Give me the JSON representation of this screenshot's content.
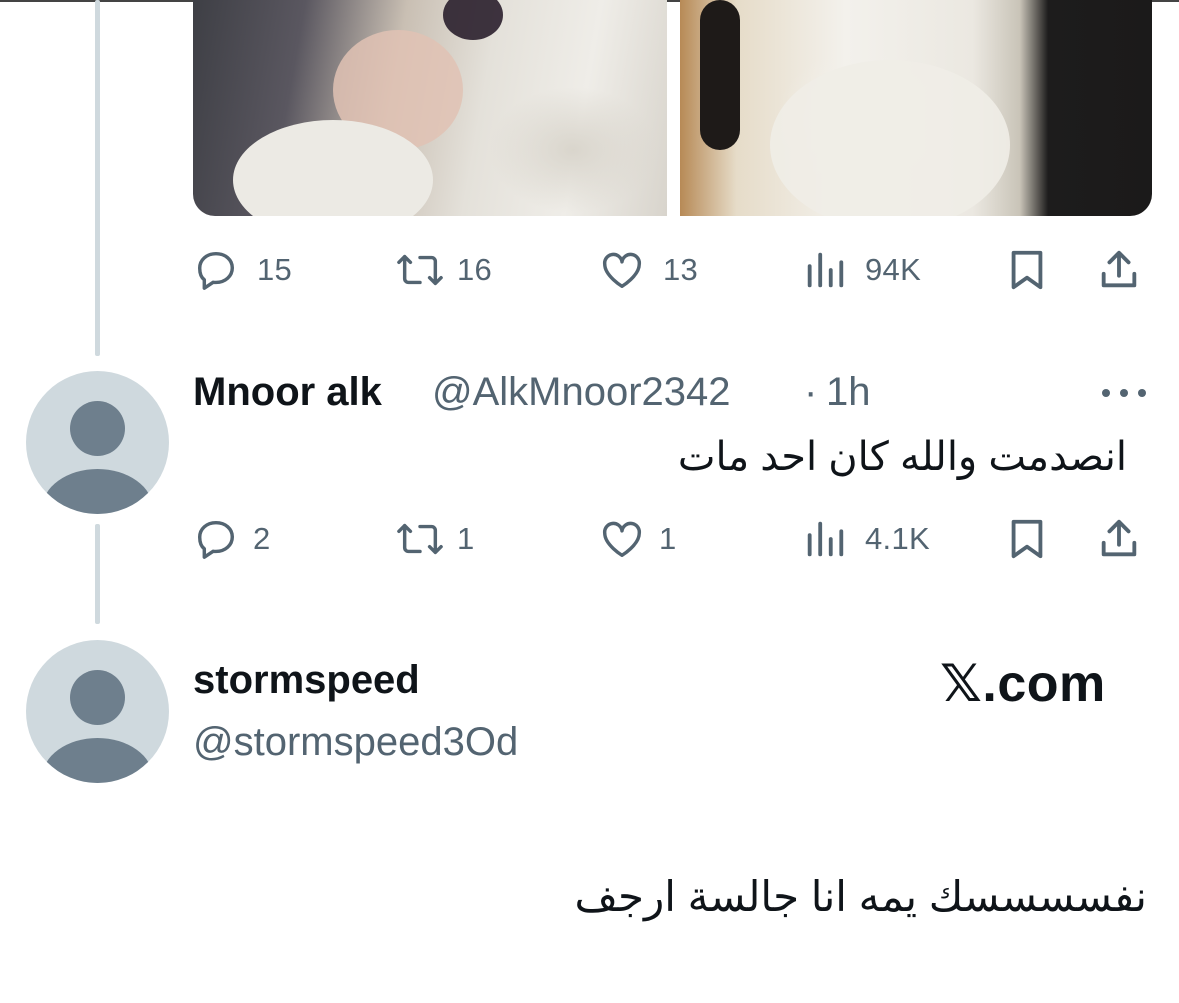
{
  "tweet1": {
    "actions": {
      "replies": "15",
      "retweets": "16",
      "likes": "13",
      "views": "94K"
    }
  },
  "reply1": {
    "name": "Mnoor alk",
    "handle": "@AlkMnoor2342",
    "separator": "·",
    "time": "1h",
    "text": "انصدمت والله كان احد مات",
    "actions": {
      "replies": "2",
      "retweets": "1",
      "likes": "1",
      "views": "4.1K"
    }
  },
  "reply2": {
    "name": "stormspeed",
    "handle": "@stormspeed3Od",
    "text": "نفسسسسك يمه انا جالسة ارجف"
  },
  "brand": {
    "text": "𝕏.com"
  },
  "icons": {
    "reply": "reply-icon",
    "retweet": "retweet-icon",
    "like": "heart-icon",
    "views": "views-icon",
    "bookmark": "bookmark-icon",
    "share": "share-icon",
    "more": "more-icon"
  },
  "colors": {
    "text": "#0f1419",
    "secondary": "#536471",
    "thread_line": "#cfd9de"
  }
}
